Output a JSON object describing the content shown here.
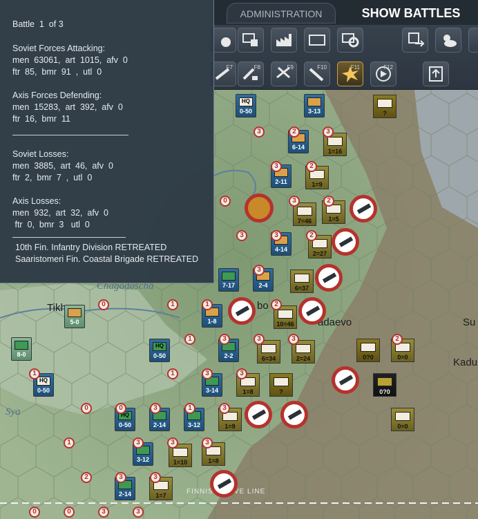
{
  "tabs": {
    "administration": "ADMINISTRATION",
    "show_battles": "SHOW BATTLES"
  },
  "toolbar": {
    "fkeys": [
      "F7",
      "F8",
      "F9",
      "F10",
      "F11",
      "F12"
    ]
  },
  "popup": {
    "battle": "Battle  1  of 3",
    "soviet_attacking_title": "Soviet Forces Attacking:",
    "soviet_attacking_1": "men  63061,  art  1015,  afv  0",
    "soviet_attacking_2": "ftr  85,  bmr  91  ,  utl  0",
    "axis_defending_title": "Axis Forces Defending:",
    "axis_defending_1": "men  15283,  art  392,  afv  0",
    "axis_defending_2": "ftr  16,  bmr  11",
    "soviet_losses_title": "Soviet Losses:",
    "soviet_losses_1": "men  3885,  art  46,  afv  0",
    "soviet_losses_2": "ftr  2,  bmr  7  ,  utl  0",
    "axis_losses_title": "Axis Losses:",
    "axis_losses_1": "men  932,  art  32,  afv  0",
    "axis_losses_2": " ftr  0,  bmr  3   utl  0",
    "result_1": "10th Fin. Infantry Division RETREATED",
    "result_2": "Saaristomeri Fin. Coastal Brigade RETREATED"
  },
  "map": {
    "labels": {
      "chagodoscha": "Chagodoscha",
      "tikh": "Tikh",
      "adaevo": "adaevo",
      "bo": "bo",
      "kadu": "Kadu",
      "su": "Su",
      "sya": "Sya",
      "move_line": "FINNISH MOVE LINE"
    },
    "units": [
      {
        "label": "0-50",
        "hq": "HQ"
      },
      {
        "label": "3-13"
      },
      {
        "label": "?"
      },
      {
        "label": "6-14"
      },
      {
        "label": "1=16"
      },
      {
        "label": "2-11"
      },
      {
        "label": "1=9"
      },
      {
        "label": "7=46"
      },
      {
        "label": "1=5"
      },
      {
        "label": "4-14"
      },
      {
        "label": "2=27"
      },
      {
        "label": "7-17"
      },
      {
        "label": "2-4"
      },
      {
        "label": "6=37"
      },
      {
        "label": "5-0"
      },
      {
        "label": "1-8"
      },
      {
        "label": "10=46"
      },
      {
        "label": "8-0"
      },
      {
        "label": "0-50",
        "hq": "HQ"
      },
      {
        "label": "2-2"
      },
      {
        "label": "6=34"
      },
      {
        "label": "2=24"
      },
      {
        "label": "0?0"
      },
      {
        "label": "0=0"
      },
      {
        "label": "0-50",
        "hq": "HQ"
      },
      {
        "label": "3-14"
      },
      {
        "label": "1=8"
      },
      {
        "label": "?"
      },
      {
        "label": "0?0"
      },
      {
        "label": "0-50",
        "hq": "HQ"
      },
      {
        "label": "2-14"
      },
      {
        "label": "3-12"
      },
      {
        "label": "1=9"
      },
      {
        "label": "0=0"
      },
      {
        "label": "3-12"
      },
      {
        "label": "1=10"
      },
      {
        "label": "1=8"
      },
      {
        "label": "2-14"
      },
      {
        "label": "1=7"
      }
    ],
    "circle_numbers": [
      "3",
      "2",
      "3",
      "3",
      "2",
      "0",
      "3",
      "2",
      "3",
      "3",
      "2",
      "3",
      "1",
      "0",
      "1",
      "1",
      "1",
      "3",
      "2",
      "3",
      "1",
      "1",
      "3",
      "3",
      "3",
      "2",
      "0",
      "0",
      "3",
      "3",
      "3",
      "3",
      "1",
      "3",
      "3",
      "2",
      "3",
      "0",
      "0",
      "3",
      "3"
    ]
  }
}
